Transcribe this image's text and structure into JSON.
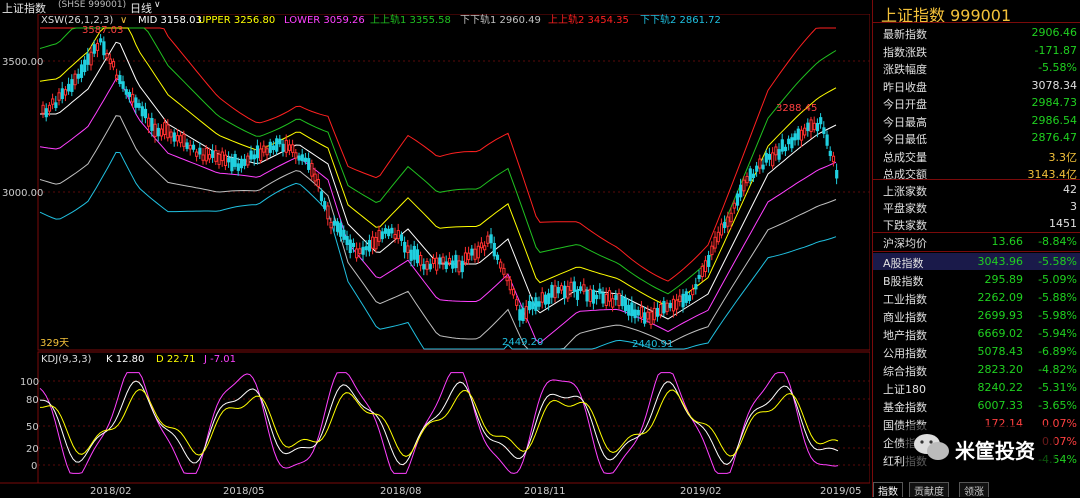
{
  "topbar": {
    "title": "上证指数",
    "period": "日线",
    "chevron": "∨"
  },
  "main": {
    "indicator": {
      "name": "XSW(26,1,2,3)",
      "mid": "MID 3158.03",
      "upper": "UPPER 3256.80",
      "lower": "LOWER 3059.26",
      "up1": "上上轨1 3355.58",
      "down1": "下下轨1 2960.49",
      "up2": "上上轨2 3454.35",
      "down2": "下下轨2 2861.72"
    },
    "code_label": "(SHSE 999001)",
    "y_labels": [
      "3500.00",
      "3000.00"
    ],
    "peak_labels": [
      "3587.03",
      "3288.45",
      "2449.20",
      "2440.91"
    ],
    "days_label": "329天",
    "colors": {
      "mid": "#ffffff",
      "upper": "#ffff00",
      "lower": "#ff40ff",
      "up1": "#20c020",
      "down1": "#c0c0c0",
      "up2": "#ff2020",
      "down2": "#20c0e0"
    }
  },
  "kdj": {
    "name": "KDJ(9,3,3)",
    "k": "K 12.80",
    "d": "D 22.71",
    "j": "J -7.01",
    "y_labels": [
      "100",
      "80",
      "50",
      "20",
      "0"
    ]
  },
  "x_axis": [
    "2018/02",
    "2018/05",
    "2018/08",
    "2018/11",
    "2019/02",
    "2019/05"
  ],
  "panel": {
    "title": "上证指数  999001",
    "stats": [
      {
        "k": "最新指数",
        "v": "2906.46",
        "c": "#20d020"
      },
      {
        "k": "指数涨跌",
        "v": "-171.87",
        "c": "#20d020"
      },
      {
        "k": "涨跌幅度",
        "v": "-5.58%",
        "c": "#20d020"
      },
      {
        "k": "昨日收盘",
        "v": "3078.34",
        "c": "#e0e0e0"
      },
      {
        "k": "今日开盘",
        "v": "2984.73",
        "c": "#20d020"
      },
      {
        "k": "今日最高",
        "v": "2986.54",
        "c": "#20d020"
      },
      {
        "k": "今日最低",
        "v": "2876.47",
        "c": "#20d020"
      },
      {
        "k": "总成交量",
        "v": "3.3亿",
        "c": "#f3c13a"
      },
      {
        "k": "总成交额",
        "v": "3143.4亿",
        "c": "#f3c13a"
      }
    ],
    "counts": [
      {
        "k": "上涨家数",
        "v": "42",
        "c": "#e0e0e0"
      },
      {
        "k": "平盘家数",
        "v": "3",
        "c": "#e0e0e0"
      },
      {
        "k": "下跌家数",
        "v": "1451",
        "c": "#e0e0e0"
      }
    ],
    "hs": {
      "k": "沪深均价",
      "v1": "13.66",
      "v2": "-8.84%"
    },
    "indices": [
      {
        "k": "A股指数",
        "v1": "3043.96",
        "v2": "-5.58%",
        "hl": true
      },
      {
        "k": "B股指数",
        "v1": "295.89",
        "v2": "-5.09%"
      },
      {
        "k": "工业指数",
        "v1": "2262.09",
        "v2": "-5.88%"
      },
      {
        "k": "商业指数",
        "v1": "2699.93",
        "v2": "-5.98%"
      },
      {
        "k": "地产指数",
        "v1": "6669.02",
        "v2": "-5.94%"
      },
      {
        "k": "公用指数",
        "v1": "5078.43",
        "v2": "-6.89%"
      },
      {
        "k": "综合指数",
        "v1": "2823.20",
        "v2": "-4.82%"
      },
      {
        "k": "上证180",
        "v1": "8240.22",
        "v2": "-5.31%"
      },
      {
        "k": "基金指数",
        "v1": "6007.33",
        "v2": "-3.65%"
      },
      {
        "k": "国债指数",
        "v1": "172.14",
        "v2": "0.07%",
        "red": true
      },
      {
        "k": "企债指数",
        "v1": "",
        "v2": "0.07%",
        "red": true
      },
      {
        "k": "红利指数",
        "v1": "",
        "v2": "-4.54%"
      }
    ],
    "tabs": [
      "指数",
      "贡献度",
      "领涨"
    ]
  },
  "watermark": {
    "text": "米筐投资"
  }
}
